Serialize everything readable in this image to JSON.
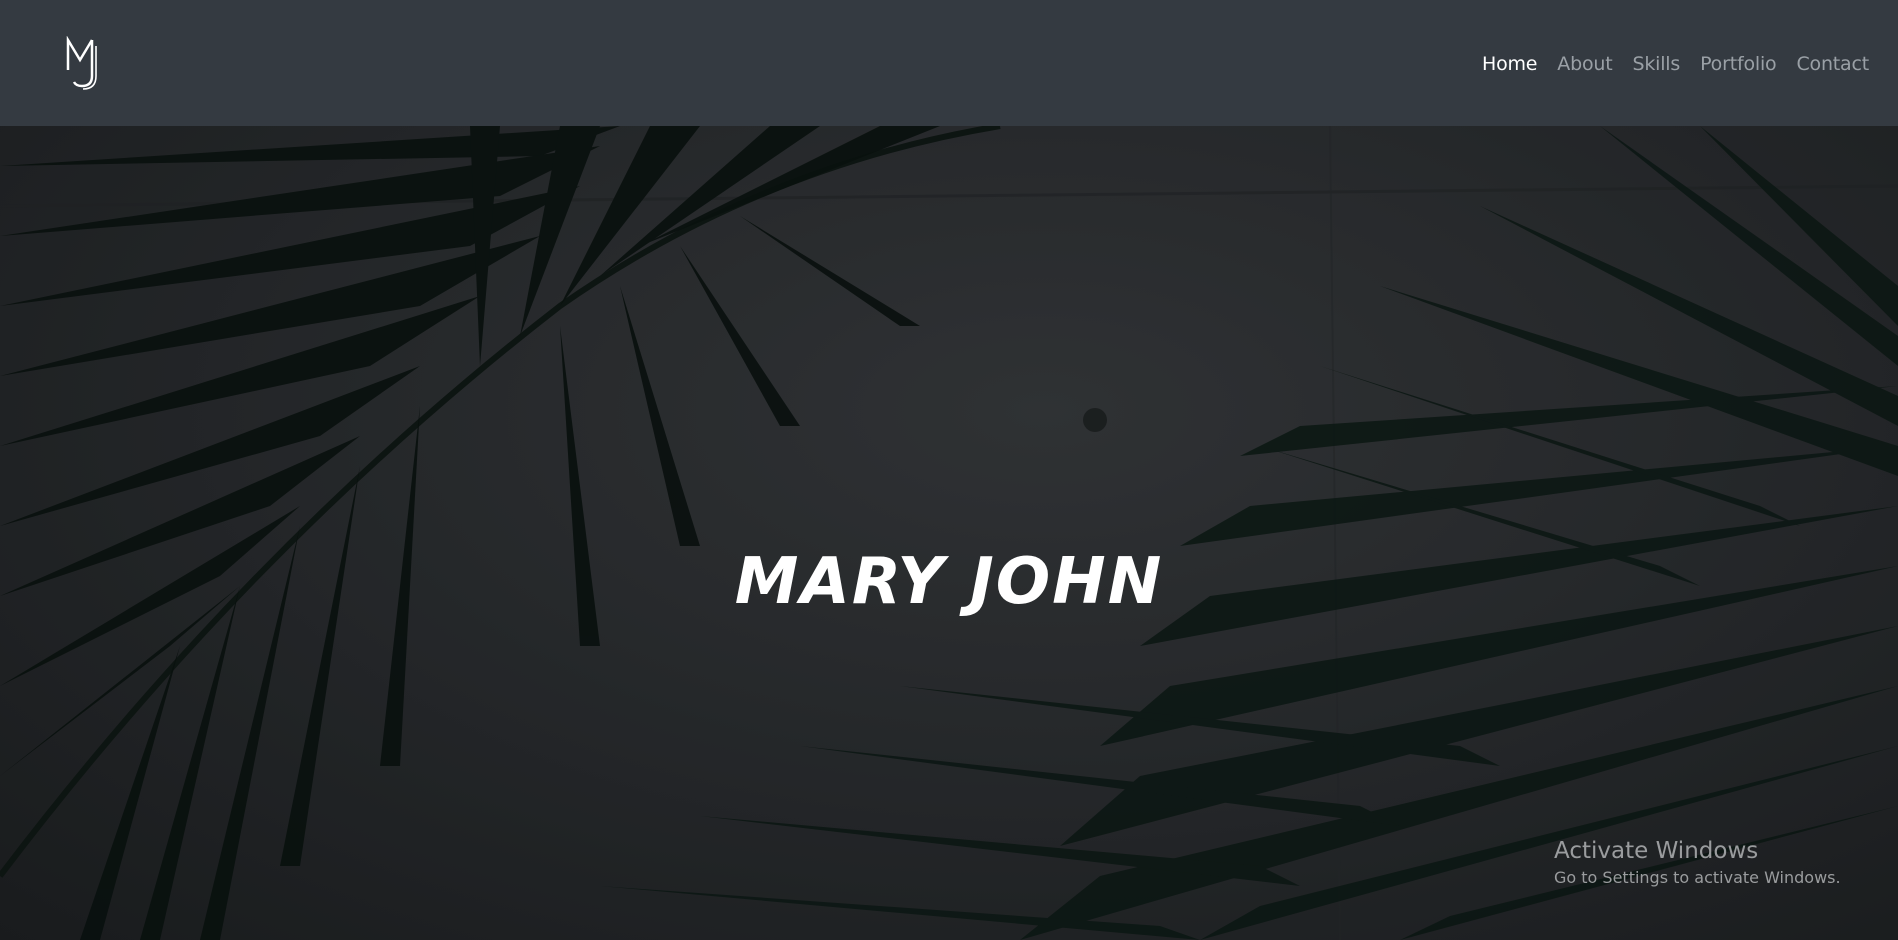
{
  "brand": {
    "logo_icon": "mj-monogram-icon",
    "logo_text": "MJ"
  },
  "nav": {
    "items": [
      {
        "label": "Home",
        "active": true
      },
      {
        "label": "About",
        "active": false
      },
      {
        "label": "Skills",
        "active": false
      },
      {
        "label": "Portfolio",
        "active": false
      },
      {
        "label": "Contact",
        "active": false
      }
    ]
  },
  "hero": {
    "title": "MARY JOHN",
    "background": "palm-leaves-photo"
  },
  "watermark": {
    "title": "Activate Windows",
    "subtitle": "Go to Settings to activate Windows."
  },
  "colors": {
    "navbar_bg": "#343a41",
    "nav_active": "#ffffff",
    "nav_inactive": "#9aa0a6",
    "hero_bg": "#2e3134",
    "leaf": "#0f1a16"
  }
}
